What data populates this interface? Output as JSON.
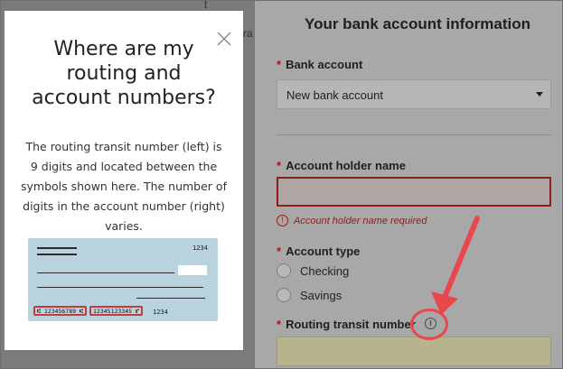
{
  "background_page": {
    "ghost_text_1": "t",
    "ghost_text_2": "ra"
  },
  "form": {
    "section_title": "Your bank account information",
    "required_marker": "*",
    "bank_account": {
      "label": "Bank account",
      "selected": "New bank account"
    },
    "account_holder": {
      "label": "Account holder name",
      "value": "",
      "error": "Account holder name required",
      "error_icon": "!"
    },
    "account_type": {
      "label": "Account type",
      "options": [
        "Checking",
        "Savings"
      ]
    },
    "routing": {
      "label": "Routing transit number",
      "info_icon": "i",
      "value": ""
    }
  },
  "modal": {
    "title": "Where are my routing and account numbers?",
    "body": "The routing transit number (left) is 9 digits and located between the symbols shown here. The number of digits in the account number (right) varies.",
    "check": {
      "check_number_top": "1234",
      "routing_number": "⑆ 123456789 ⑆",
      "account_number": "12345123345 ⑈",
      "check_number_bottom": "1234"
    }
  },
  "colors": {
    "required_red": "#b0140f",
    "annotation_red": "#e8474c",
    "check_blue": "#b8d3de"
  }
}
